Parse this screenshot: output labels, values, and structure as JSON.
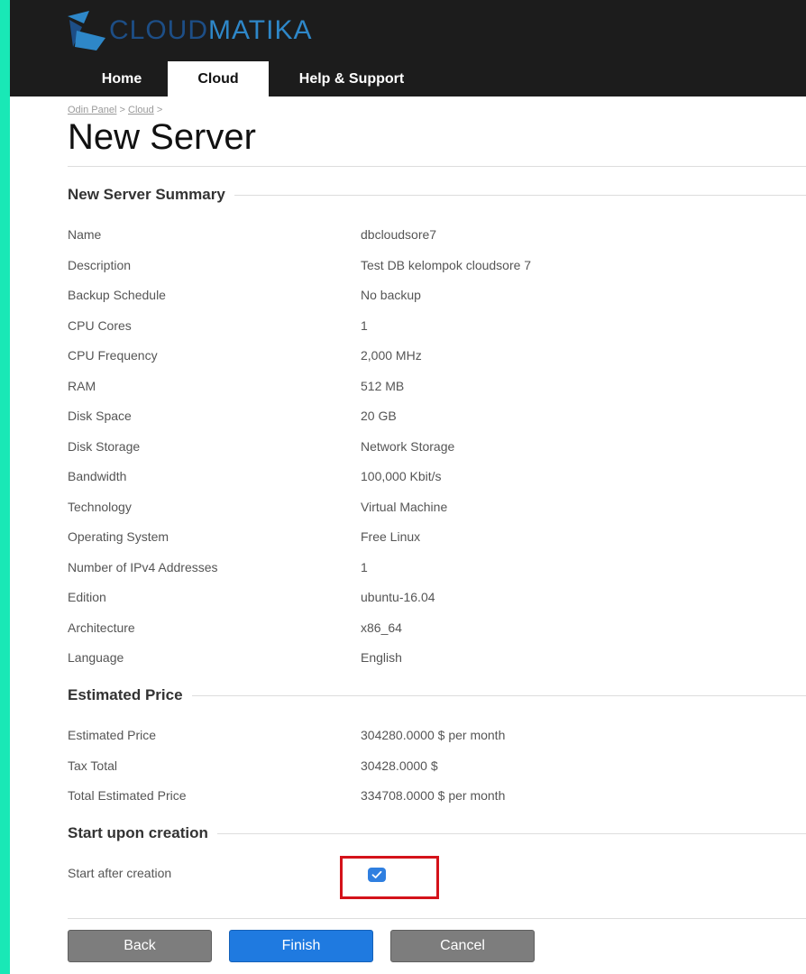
{
  "brand": {
    "name_part1": "CLOUD",
    "name_part2": "MATIKA"
  },
  "nav": {
    "home": "Home",
    "cloud": "Cloud",
    "help": "Help & Support"
  },
  "breadcrumb": {
    "item1": "Odin Panel",
    "sep": ">",
    "item2": "Cloud"
  },
  "page": {
    "title": "New Server"
  },
  "summary": {
    "heading": "New Server Summary",
    "rows": [
      {
        "label": "Name",
        "value": "dbcloudsore7"
      },
      {
        "label": "Description",
        "value": "Test DB kelompok cloudsore 7"
      },
      {
        "label": "Backup Schedule",
        "value": "No backup"
      },
      {
        "label": "CPU Cores",
        "value": "1"
      },
      {
        "label": "CPU Frequency",
        "value": "2,000 MHz"
      },
      {
        "label": "RAM",
        "value": "512 MB"
      },
      {
        "label": "Disk Space",
        "value": "20 GB"
      },
      {
        "label": "Disk Storage",
        "value": "Network Storage"
      },
      {
        "label": "Bandwidth",
        "value": "100,000 Kbit/s"
      },
      {
        "label": "Technology",
        "value": "Virtual Machine"
      },
      {
        "label": "Operating System",
        "value": "Free Linux"
      },
      {
        "label": "Number of IPv4 Addresses",
        "value": "1"
      },
      {
        "label": "Edition",
        "value": "ubuntu-16.04"
      },
      {
        "label": "Architecture",
        "value": "x86_64"
      },
      {
        "label": "Language",
        "value": "English"
      }
    ]
  },
  "price": {
    "heading": "Estimated Price",
    "rows": [
      {
        "label": "Estimated Price",
        "value": "304280.0000 $ per month"
      },
      {
        "label": "Tax Total",
        "value": "30428.0000 $"
      },
      {
        "label": "Total Estimated Price",
        "value": "334708.0000 $ per month"
      }
    ]
  },
  "start": {
    "heading": "Start upon creation",
    "label": "Start after creation",
    "checked": true
  },
  "buttons": {
    "back": "Back",
    "finish": "Finish",
    "cancel": "Cancel"
  },
  "colors": {
    "accent_strip": "#19e8b6",
    "header_bg": "#1c1c1c",
    "primary": "#1f7ae0",
    "highlight": "#d4121a"
  }
}
